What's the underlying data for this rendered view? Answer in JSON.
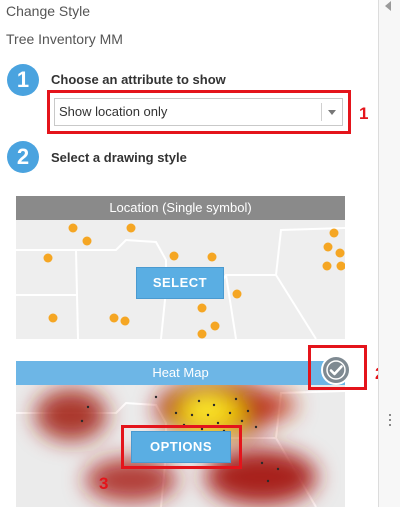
{
  "panel": {
    "title": "Change Style",
    "layer_name": "Tree Inventory MM"
  },
  "steps": [
    {
      "number": "1",
      "label": "Choose an attribute to show"
    },
    {
      "number": "2",
      "label": "Select a drawing style"
    }
  ],
  "attribute_select": {
    "selected": "Show location only"
  },
  "styles": [
    {
      "header": "Location (Single symbol)",
      "button": "SELECT"
    },
    {
      "header": "Heat Map",
      "button": "OPTIONS",
      "selected": true
    }
  ],
  "callouts": [
    "1",
    "2",
    "3"
  ],
  "colors": {
    "accent_blue": "#4aa3df",
    "button_blue": "#5aaee3",
    "callout_red": "#e4141b",
    "point_orange": "#f5a623"
  },
  "icons": {
    "collapse": "chevron-left-icon",
    "dropdown": "chevron-down-icon",
    "selected": "checkmark-icon",
    "resize": "drag-handle-icon"
  }
}
